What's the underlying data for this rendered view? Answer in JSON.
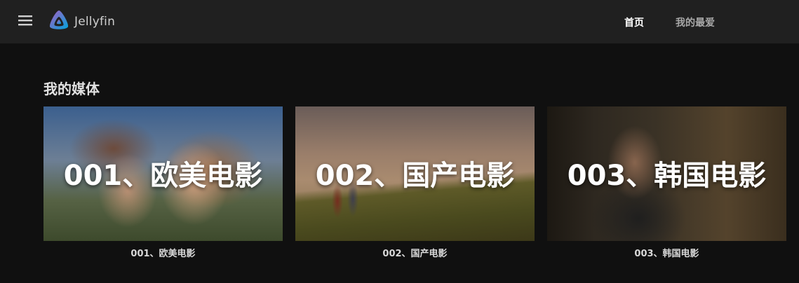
{
  "header": {
    "logo_text": "Jellyfin",
    "tabs": [
      {
        "label": "首页",
        "active": true
      },
      {
        "label": "我的最爱",
        "active": false
      }
    ]
  },
  "icons": {
    "menu": "hamburger-menu-icon",
    "logo": "jellyfin-logo-icon"
  },
  "section": {
    "title": "我的媒体"
  },
  "libraries": [
    {
      "image_title": "001、欧美电影",
      "caption": "001、欧美电影"
    },
    {
      "image_title": "002、国产电影",
      "caption": "002、国产电影"
    },
    {
      "image_title": "003、韩国电影",
      "caption": "003、韩国电影"
    }
  ],
  "colors": {
    "header_bg": "#202020",
    "page_bg": "#101010",
    "logo_gradient_start": "#aa5cc3",
    "logo_gradient_end": "#00a4dc"
  }
}
